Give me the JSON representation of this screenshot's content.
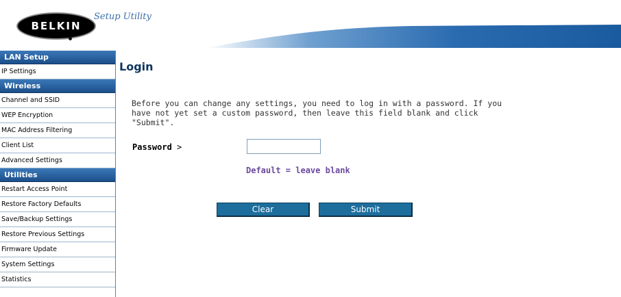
{
  "header": {
    "logo_text": "BELKIN",
    "title": "Setup Utility"
  },
  "sidebar": {
    "sections": [
      {
        "label": "LAN Setup",
        "items": [
          "IP Settings"
        ]
      },
      {
        "label": "Wireless",
        "items": [
          "Channel and SSID",
          "WEP Encryption",
          "MAC Address Filtering",
          "Client List",
          "Advanced Settings"
        ]
      },
      {
        "label": "Utilities",
        "items": [
          "Restart Access Point",
          "Restore Factory Defaults",
          "Save/Backup Settings",
          "Restore Previous Settings",
          "Firmware Update",
          "System Settings",
          "Statistics"
        ]
      }
    ]
  },
  "main": {
    "title": "Login",
    "intro": "Before you can change any settings, you need to log in with a password. If you have not yet set a custom password, then leave this field blank and click \"Submit\".",
    "password_label": "Password",
    "password_suffix": ">",
    "password_value": "",
    "default_note": "Default = leave blank",
    "clear_label": "Clear",
    "submit_label": "Submit"
  },
  "colors": {
    "brand_blue": "#1b4f8a",
    "button_blue": "#1d6e9c",
    "note_purple": "#6b4a9e"
  }
}
